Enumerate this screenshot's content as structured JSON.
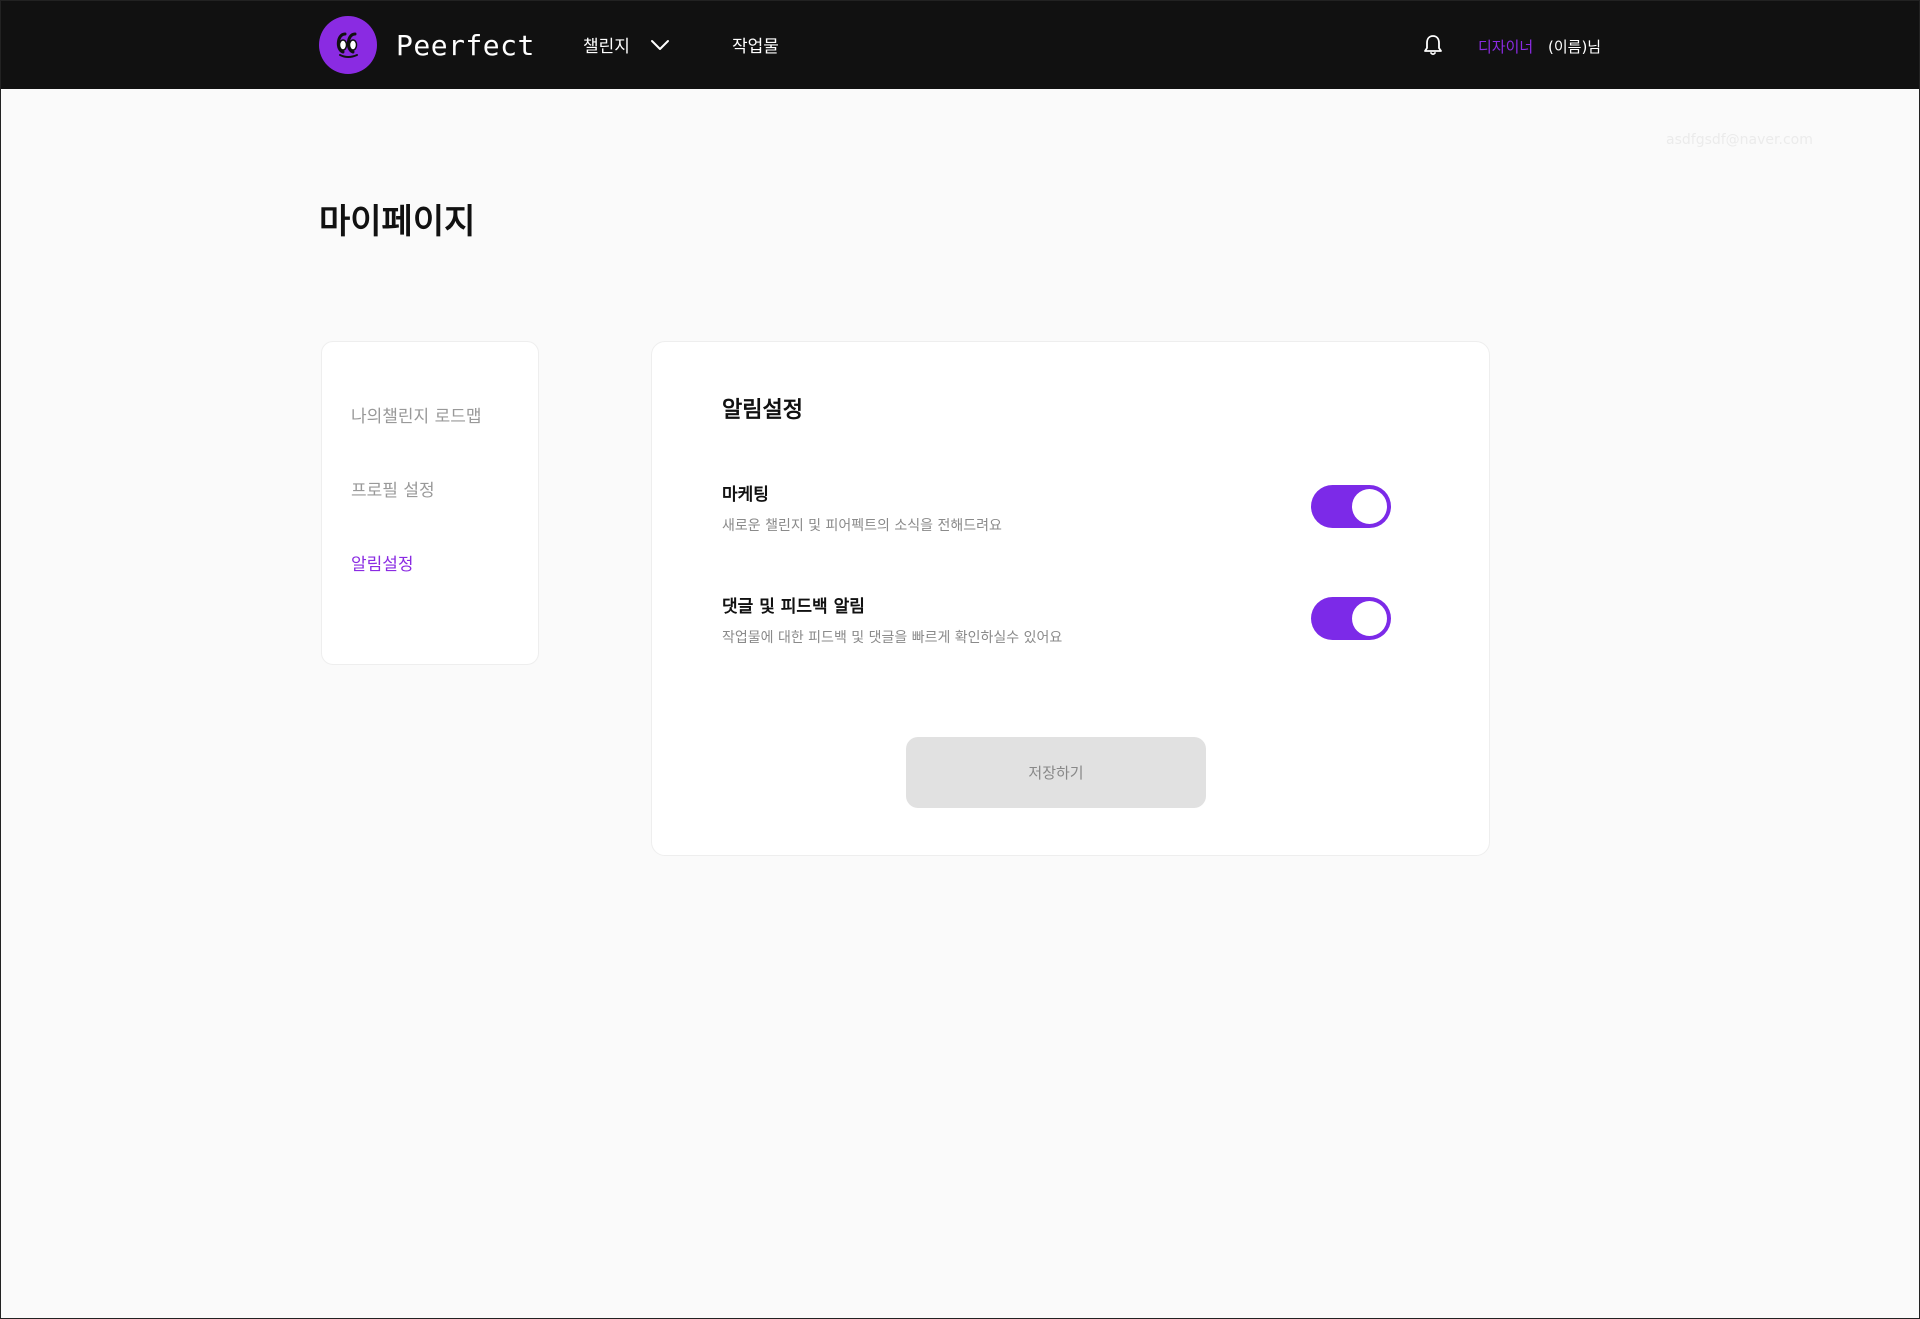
{
  "header": {
    "brand": "Peerfect",
    "nav": {
      "challenge": "챌린지",
      "works": "작업물"
    },
    "user": {
      "role": "디자이너",
      "name": "(이름)님"
    },
    "icons": {
      "logo": "peerfect-logo-icon",
      "dropdown": "chevron-down-icon",
      "bell": "bell-icon"
    }
  },
  "ghost_email": "asdfgsdf@naver.com",
  "page": {
    "title": "마이페이지"
  },
  "sidebar": {
    "items": [
      {
        "label": "나의챌린지 로드맵",
        "active": false
      },
      {
        "label": "프로필 설정",
        "active": false
      },
      {
        "label": "알림설정",
        "active": true
      }
    ]
  },
  "panel": {
    "title": "알림설정",
    "settings": [
      {
        "title": "마케팅",
        "description": "새로운 챌린지 및 피어펙트의 소식을 전해드려요",
        "enabled": true
      },
      {
        "title": "댓글 및 피드백 알림",
        "description": "작업물에 대한 피드백 및 댓글을 빠르게 확인하실수 있어요",
        "enabled": true
      }
    ],
    "save_label": "저장하기"
  },
  "colors": {
    "accent": "#8a2be2",
    "toggle_on": "#7c2ae8",
    "header_bg": "#111111",
    "page_bg": "#fafafa",
    "button_disabled": "#e1e1e1"
  }
}
